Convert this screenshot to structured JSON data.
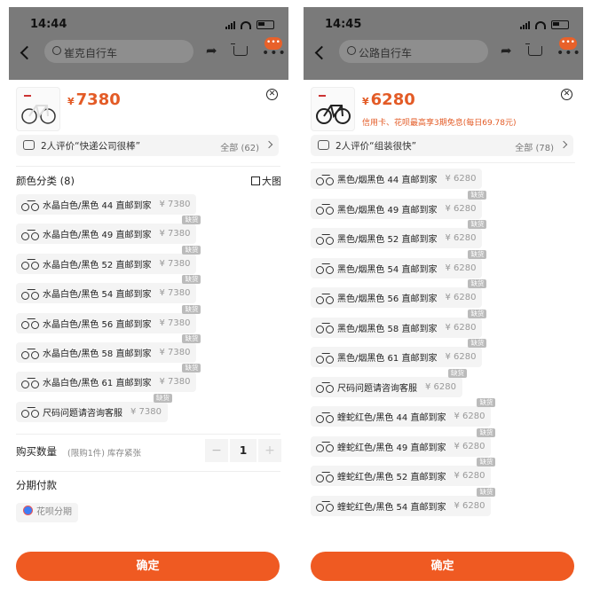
{
  "left": {
    "status": {
      "time": "14:44"
    },
    "search": {
      "placeholder": "崔克自行车"
    },
    "product": {
      "currency": "¥",
      "price": "7380"
    },
    "review": {
      "text": "2人评价“快递公司很棒”",
      "all": "全部 (62)"
    },
    "color_section": {
      "title": "颜色分类 (8)",
      "big_pic": "大图"
    },
    "options": [
      {
        "name": "水晶白色/黑色 44 直邮到家",
        "price": "¥ 7380",
        "out_of_stock": false
      },
      {
        "name": "水晶白色/黑色 49 直邮到家",
        "price": "¥ 7380",
        "out_of_stock": true
      },
      {
        "name": "水晶白色/黑色 52 直邮到家",
        "price": "¥ 7380",
        "out_of_stock": true
      },
      {
        "name": "水晶白色/黑色 54 直邮到家",
        "price": "¥ 7380",
        "out_of_stock": true
      },
      {
        "name": "水晶白色/黑色 56 直邮到家",
        "price": "¥ 7380",
        "out_of_stock": true
      },
      {
        "name": "水晶白色/黑色 58 直邮到家",
        "price": "¥ 7380",
        "out_of_stock": true
      },
      {
        "name": "水晶白色/黑色 61 直邮到家",
        "price": "¥ 7380",
        "out_of_stock": true
      },
      {
        "name": "尺码问题请咨询客服",
        "price": "¥ 7380",
        "out_of_stock": true
      }
    ],
    "out_of_stock_label": "缺货",
    "quantity": {
      "label": "购买数量",
      "note": "(限购1件) 库存紧张",
      "value": "1",
      "minus": "−",
      "plus": "+"
    },
    "installment": {
      "title": "分期付款",
      "option": "花呗分期"
    },
    "confirm": "确定"
  },
  "right": {
    "status": {
      "time": "14:45"
    },
    "search": {
      "placeholder": "公路自行车"
    },
    "product": {
      "currency": "¥",
      "price": "6280",
      "installment_note": "信用卡、花呗最高享3期免息(每日69.78元)"
    },
    "review": {
      "text": "2人评价“组装很快”",
      "all": "全部 (78)"
    },
    "options": [
      {
        "name": "黑色/烟黑色 44 直邮到家",
        "price": "¥ 6280",
        "out_of_stock": false
      },
      {
        "name": "黑色/烟黑色 49 直邮到家",
        "price": "¥ 6280",
        "out_of_stock": true
      },
      {
        "name": "黑色/烟黑色 52 直邮到家",
        "price": "¥ 6280",
        "out_of_stock": true
      },
      {
        "name": "黑色/烟黑色 54 直邮到家",
        "price": "¥ 6280",
        "out_of_stock": true
      },
      {
        "name": "黑色/烟黑色 56 直邮到家",
        "price": "¥ 6280",
        "out_of_stock": true
      },
      {
        "name": "黑色/烟黑色 58 直邮到家",
        "price": "¥ 6280",
        "out_of_stock": true
      },
      {
        "name": "黑色/烟黑色 61 直邮到家",
        "price": "¥ 6280",
        "out_of_stock": true
      },
      {
        "name": "尺码问题请咨询客服",
        "price": "¥ 6280",
        "out_of_stock": true
      },
      {
        "name": "蝰蛇红色/黑色 44 直邮到家",
        "price": "¥ 6280",
        "out_of_stock": true
      },
      {
        "name": "蝰蛇红色/黑色 49 直邮到家",
        "price": "¥ 6280",
        "out_of_stock": true
      },
      {
        "name": "蝰蛇红色/黑色 52 直邮到家",
        "price": "¥ 6280",
        "out_of_stock": true
      },
      {
        "name": "蝰蛇红色/黑色 54 直邮到家",
        "price": "¥ 6280",
        "out_of_stock": true
      }
    ],
    "out_of_stock_label": "缺货",
    "confirm": "确定"
  },
  "colors": {
    "accent": "#ef5a22",
    "price": "#e35b26"
  },
  "icons": [
    "back-arrow-icon",
    "search-icon",
    "share-icon",
    "cart-icon",
    "more-icon",
    "close-icon",
    "comment-icon",
    "chevron-right-icon",
    "grid-icon",
    "bike-icon",
    "huabei-icon"
  ]
}
